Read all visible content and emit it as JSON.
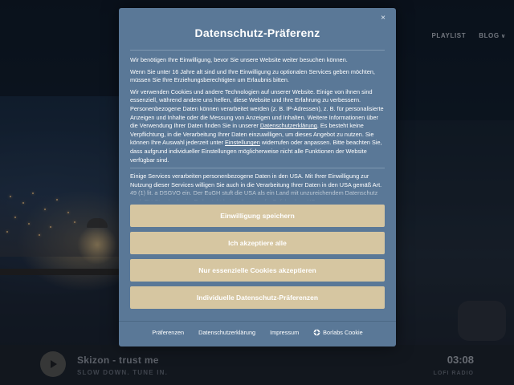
{
  "site": {
    "nav": [
      {
        "label": "PLAYLIST"
      },
      {
        "label": "BLOG"
      }
    ],
    "nav_chevron": "∨"
  },
  "player": {
    "track_title": "Skizon - trust me",
    "tagline": "SLOW DOWN. TUNE IN.",
    "time": "03:08",
    "station": "LOFI RADIO"
  },
  "dialog": {
    "title": "Datenschutz-Präferenz",
    "close_label": "×",
    "p1": "Wir benötigen Ihre Einwilligung, bevor Sie unsere Website weiter besuchen können.",
    "p2": "Wenn Sie unter 16 Jahre alt sind und Ihre Einwilligung zu optionalen Services geben möchten, müssen Sie Ihre Erziehungsberechtigten um Erlaubnis bitten.",
    "p3_a": "Wir verwenden Cookies und andere Technologien auf unserer Website. Einige von ihnen sind essenziell, während andere uns helfen, diese Website und Ihre Erfahrung zu verbessern. Personenbezogene Daten können verarbeitet werden (z. B. IP-Adressen), z. B. für personalisierte Anzeigen und Inhalte oder die Messung von Anzeigen und Inhalten. Weitere Informationen über die Verwendung Ihrer Daten finden Sie in unserer ",
    "p3_link1": "Datenschutzerklärung",
    "p3_b": ". Es besteht keine Verpflichtung, in die Verarbeitung Ihrer Daten einzuwilligen, um dieses Angebot zu nutzen. Sie können Ihre Auswahl jederzeit unter ",
    "p3_link2": "Einstellungen",
    "p3_c": " widerrufen oder anpassen. Bitte beachten Sie, dass aufgrund individueller Einstellungen möglicherweise nicht alle Funktionen der Website verfügbar sind.",
    "p4": "Einige Services verarbeiten personenbezogene Daten in den USA. Mit Ihrer Einwilligung zur Nutzung dieser Services willigen Sie auch in die Verarbeitung Ihrer Daten in den USA gemäß Art. 49 (1) lit. a DSGVO ein. Der EuGH stuft die USA als ein Land mit unzureichendem Datenschutz nach EU-Standards ein. Es besteht beispielsweise die Gefahr, dass US-",
    "buttons": {
      "save": "Einwilligung speichern",
      "accept_all": "Ich akzeptiere alle",
      "essential_only": "Nur essenzielle Cookies akzeptieren",
      "individual": "Individuelle Datenschutz-Präferenzen"
    },
    "footer": {
      "preferences": "Präferenzen",
      "privacy": "Datenschutzerklärung",
      "imprint": "Impressum",
      "borlabs": "Borlabs Cookie"
    }
  },
  "colors": {
    "dialog_bg": "#5a7897",
    "button_bg": "#d6c6a1",
    "button_text": "#ffffff",
    "overlay": "#0e1620"
  }
}
